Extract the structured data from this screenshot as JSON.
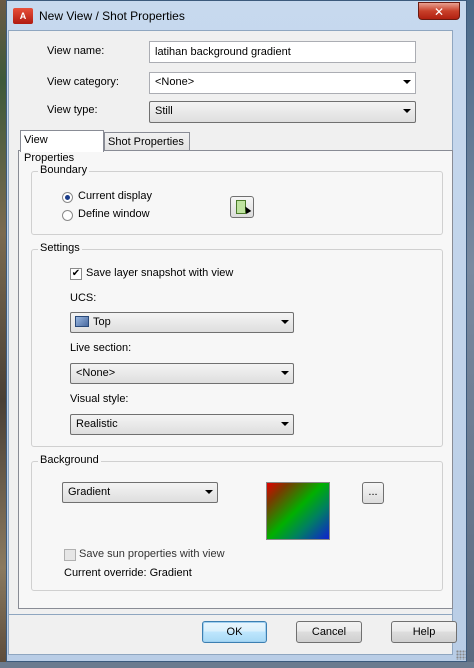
{
  "window": {
    "title": "New View / Shot Properties",
    "app_icon_text": "A",
    "close_label": "✕"
  },
  "view_name": {
    "label": "View name:",
    "value": "latihan background gradient"
  },
  "view_category": {
    "label": "View category:",
    "value": "<None>"
  },
  "view_type": {
    "label": "View type:",
    "value": "Still"
  },
  "tabs": [
    {
      "label": "View Properties",
      "active": true
    },
    {
      "label": "Shot Properties",
      "active": false
    }
  ],
  "boundary": {
    "title": "Boundary",
    "options": [
      {
        "label": "Current display",
        "selected": true
      },
      {
        "label": "Define window",
        "selected": false
      }
    ],
    "pick_icon": "define-window-pick-icon"
  },
  "settings": {
    "title": "Settings",
    "save_layer_snapshot": {
      "label": "Save layer snapshot with view",
      "checked": true
    },
    "ucs": {
      "label": "UCS:",
      "value": "Top",
      "icon": "ucs-icon"
    },
    "live_section": {
      "label": "Live section:",
      "value": "<None>"
    },
    "visual_style": {
      "label": "Visual style:",
      "value": "Realistic"
    }
  },
  "background": {
    "title": "Background",
    "type_value": "Gradient",
    "ellipsis_label": "...",
    "save_sun": {
      "label": "Save sun properties with view",
      "checked": false,
      "enabled": false
    },
    "current_override": "Current override: Gradient"
  },
  "buttons": {
    "ok": "OK",
    "cancel": "Cancel",
    "help": "Help"
  },
  "colors": {
    "title_bar": "#c7d9ee",
    "default_button": "#bee6fd",
    "panel": "#f0f0f0"
  }
}
